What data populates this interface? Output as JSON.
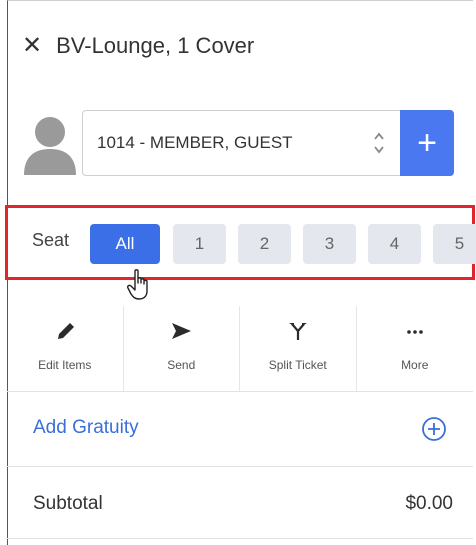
{
  "header": {
    "close_icon": "close-icon",
    "title": "BV-Lounge, 1 Cover"
  },
  "guest": {
    "avatar_icon": "avatar-icon",
    "selected": "1014 - MEMBER, GUEST",
    "add_label": "+"
  },
  "seats": {
    "label": "Seat",
    "buttons": [
      "All",
      "1",
      "2",
      "3",
      "4",
      "5"
    ],
    "selected": "All",
    "colors": {
      "active": "#3b6fe8",
      "inactive": "#e4e7ed",
      "highlight_border": "#e0262b"
    }
  },
  "actions": [
    {
      "label": "Edit Items",
      "icon": "pencil-icon"
    },
    {
      "label": "Send",
      "icon": "send-icon"
    },
    {
      "label": "Split Ticket",
      "icon": "split-icon"
    },
    {
      "label": "More",
      "icon": "more-icon"
    }
  ],
  "gratuity": {
    "label": "Add Gratuity",
    "icon": "add-circle-icon",
    "color": "#3a6fd8"
  },
  "subtotal": {
    "label": "Subtotal",
    "value": "$0.00"
  }
}
